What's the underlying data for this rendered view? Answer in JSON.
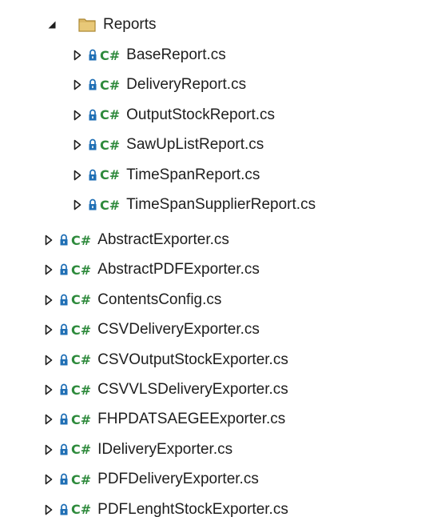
{
  "folder": {
    "label": "Reports",
    "expanded": true,
    "icon": "folder-icon",
    "color": "#c9a44c"
  },
  "file_icon_label": "C#",
  "children": [
    {
      "label": "BaseReport.cs"
    },
    {
      "label": "DeliveryReport.cs"
    },
    {
      "label": "OutputStockReport.cs"
    },
    {
      "label": "SawUpListReport.cs"
    },
    {
      "label": "TimeSpanReport.cs"
    },
    {
      "label": "TimeSpanSupplierReport.cs"
    }
  ],
  "files": [
    {
      "label": "AbstractExporter.cs"
    },
    {
      "label": "AbstractPDFExporter.cs"
    },
    {
      "label": "ContentsConfig.cs"
    },
    {
      "label": "CSVDeliveryExporter.cs"
    },
    {
      "label": "CSVOutputStockExporter.cs"
    },
    {
      "label": "CSVVLSDeliveryExporter.cs"
    },
    {
      "label": "FHPDATSAEGEExporter.cs"
    },
    {
      "label": "IDeliveryExporter.cs"
    },
    {
      "label": "PDFDeliveryExporter.cs"
    },
    {
      "label": "PDFLenghtStockExporter.cs"
    }
  ],
  "colors": {
    "cs_badge": "#2e8a3c",
    "lock": "#1f6fb5",
    "text": "#1e1e1e"
  }
}
